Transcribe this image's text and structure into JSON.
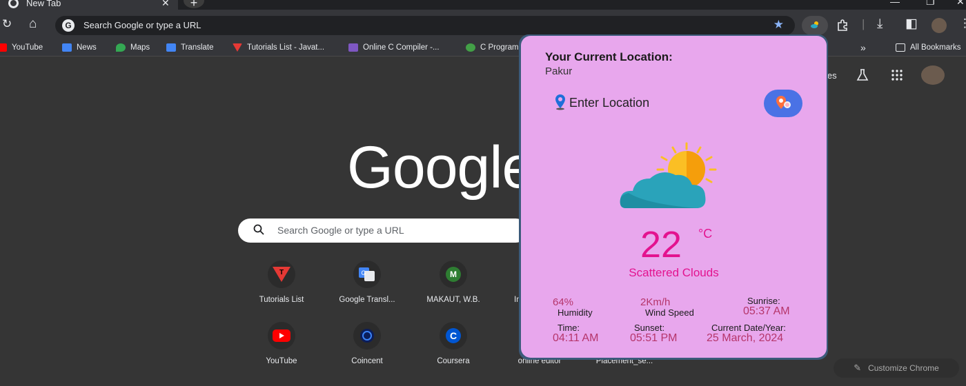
{
  "tab": {
    "title": "New Tab",
    "close": "✕",
    "new": "+"
  },
  "window": {
    "minimize": "—",
    "restore": "❐",
    "close": "✕"
  },
  "toolbar": {
    "reload": "↻",
    "home": "⌂",
    "omnibox_text": "Search Google or type a URL",
    "star": "★",
    "download": "⤓",
    "sidepanel": "◧",
    "menu": "⋮"
  },
  "bookmarks": [
    {
      "label": "YouTube",
      "color": "#ff0000"
    },
    {
      "label": "News",
      "color": "#4285f4"
    },
    {
      "label": "Maps",
      "color": "#34a853"
    },
    {
      "label": "Translate",
      "color": "#4285f4"
    },
    {
      "label": "Tutorials List - Javat...",
      "color": "#e53935"
    },
    {
      "label": "Online C Compiler -...",
      "color": "#7e57c2"
    },
    {
      "label": "C Program",
      "color": "#43a047"
    }
  ],
  "bookmarks_more": "»",
  "all_bookmarks": "All Bookmarks",
  "ntp": {
    "images_link": "Images",
    "logo": "Google",
    "search_placeholder": "Search Google or type a URL",
    "shortcuts": [
      {
        "label": "Tutorials List",
        "glyph": "T",
        "color": "#e53935"
      },
      {
        "label": "Google Transl...",
        "glyph": "G",
        "color": "#4285f4"
      },
      {
        "label": "MAKAUT, W.B.",
        "glyph": "M",
        "color": "#2e7d32"
      },
      {
        "label": "YouTube",
        "glyph": "▶",
        "color": "#ff0000"
      },
      {
        "label": "Coincent",
        "glyph": "◉",
        "color": "#1e40af"
      },
      {
        "label": "Coursera",
        "glyph": "C",
        "color": "#0056d2"
      },
      {
        "label": "online editor",
        "glyph": "",
        "color": "#444"
      },
      {
        "label": "Placement_se...",
        "glyph": "",
        "color": "#444"
      }
    ],
    "customize": "Customize Chrome"
  },
  "weather": {
    "heading": "Your Current Location:",
    "location": "Pakur",
    "input_placeholder": "Enter Location",
    "temperature": "22",
    "unit": "°C",
    "description": "Scattered Clouds",
    "humidity_value": "64%",
    "humidity_label": "Humidity",
    "wind_value": "2Km/h",
    "wind_label": "Wind Speed",
    "sunrise_label": "Sunrise:",
    "sunrise_value": "05:37 AM",
    "time_label": "Time:",
    "time_value": "04:11 AM",
    "sunset_label": "Sunset:",
    "sunset_value": "05:51 PM",
    "date_label": "Current Date/Year:",
    "date_value": "25 March, 2024"
  }
}
